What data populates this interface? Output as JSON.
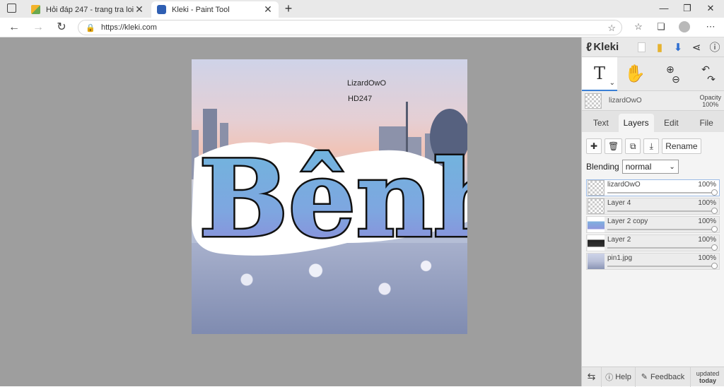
{
  "browser": {
    "tabs": [
      {
        "title": "Hỏi đáp 247 - trang tra loi",
        "active": false
      },
      {
        "title": "Kleki - Paint Tool",
        "active": true
      }
    ],
    "new_tab": "+",
    "url": "https://kleki.com",
    "window_controls": {
      "minimize": "—",
      "restore": "❐",
      "close": "✕"
    }
  },
  "canvas": {
    "text1": "LizardOwO",
    "text2": "HD247",
    "sticker_text": "Bênh"
  },
  "sidebar": {
    "logo": "Kleki",
    "layer_name": "lizardOwO",
    "opacity_label": "Opacity",
    "opacity_value": "100%",
    "tabs": [
      "Text",
      "Layers",
      "Edit",
      "File"
    ],
    "active_tab": "Layers",
    "rename_label": "Rename",
    "blending_label": "Blending",
    "blending_value": "normal",
    "layers": [
      {
        "name": "lizardOwO",
        "opacity": "100%",
        "selected": true
      },
      {
        "name": "Layer 4",
        "opacity": "100%",
        "selected": false
      },
      {
        "name": "Layer 2 copy",
        "opacity": "100%",
        "selected": false
      },
      {
        "name": "Layer 2",
        "opacity": "100%",
        "selected": false
      },
      {
        "name": "pin1.jpg",
        "opacity": "100%",
        "selected": false
      }
    ],
    "footer": {
      "help": "Help",
      "feedback": "Feedback",
      "updated": "updated",
      "today": "today"
    }
  },
  "colors": {
    "accent": "#3a7fd5",
    "workspace": "#9e9e9e"
  }
}
